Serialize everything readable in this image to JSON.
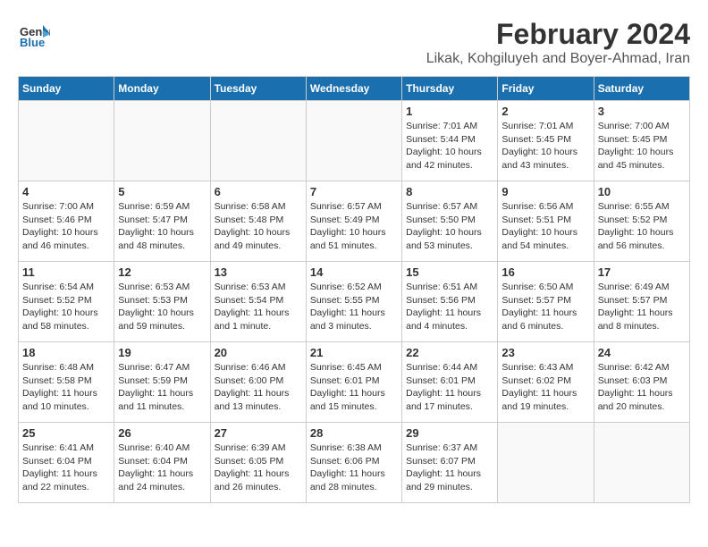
{
  "header": {
    "logo_general": "General",
    "logo_blue": "Blue",
    "month_title": "February 2024",
    "location": "Likak, Kohgiluyeh and Boyer-Ahmad, Iran"
  },
  "days_of_week": [
    "Sunday",
    "Monday",
    "Tuesday",
    "Wednesday",
    "Thursday",
    "Friday",
    "Saturday"
  ],
  "weeks": [
    [
      {
        "day": "",
        "empty": true
      },
      {
        "day": "",
        "empty": true
      },
      {
        "day": "",
        "empty": true
      },
      {
        "day": "",
        "empty": true
      },
      {
        "day": "1",
        "sunrise": "7:01 AM",
        "sunset": "5:44 PM",
        "daylight": "10 hours and 42 minutes."
      },
      {
        "day": "2",
        "sunrise": "7:01 AM",
        "sunset": "5:45 PM",
        "daylight": "10 hours and 43 minutes."
      },
      {
        "day": "3",
        "sunrise": "7:00 AM",
        "sunset": "5:45 PM",
        "daylight": "10 hours and 45 minutes."
      }
    ],
    [
      {
        "day": "4",
        "sunrise": "7:00 AM",
        "sunset": "5:46 PM",
        "daylight": "10 hours and 46 minutes."
      },
      {
        "day": "5",
        "sunrise": "6:59 AM",
        "sunset": "5:47 PM",
        "daylight": "10 hours and 48 minutes."
      },
      {
        "day": "6",
        "sunrise": "6:58 AM",
        "sunset": "5:48 PM",
        "daylight": "10 hours and 49 minutes."
      },
      {
        "day": "7",
        "sunrise": "6:57 AM",
        "sunset": "5:49 PM",
        "daylight": "10 hours and 51 minutes."
      },
      {
        "day": "8",
        "sunrise": "6:57 AM",
        "sunset": "5:50 PM",
        "daylight": "10 hours and 53 minutes."
      },
      {
        "day": "9",
        "sunrise": "6:56 AM",
        "sunset": "5:51 PM",
        "daylight": "10 hours and 54 minutes."
      },
      {
        "day": "10",
        "sunrise": "6:55 AM",
        "sunset": "5:52 PM",
        "daylight": "10 hours and 56 minutes."
      }
    ],
    [
      {
        "day": "11",
        "sunrise": "6:54 AM",
        "sunset": "5:52 PM",
        "daylight": "10 hours and 58 minutes."
      },
      {
        "day": "12",
        "sunrise": "6:53 AM",
        "sunset": "5:53 PM",
        "daylight": "10 hours and 59 minutes."
      },
      {
        "day": "13",
        "sunrise": "6:53 AM",
        "sunset": "5:54 PM",
        "daylight": "11 hours and 1 minute."
      },
      {
        "day": "14",
        "sunrise": "6:52 AM",
        "sunset": "5:55 PM",
        "daylight": "11 hours and 3 minutes."
      },
      {
        "day": "15",
        "sunrise": "6:51 AM",
        "sunset": "5:56 PM",
        "daylight": "11 hours and 4 minutes."
      },
      {
        "day": "16",
        "sunrise": "6:50 AM",
        "sunset": "5:57 PM",
        "daylight": "11 hours and 6 minutes."
      },
      {
        "day": "17",
        "sunrise": "6:49 AM",
        "sunset": "5:57 PM",
        "daylight": "11 hours and 8 minutes."
      }
    ],
    [
      {
        "day": "18",
        "sunrise": "6:48 AM",
        "sunset": "5:58 PM",
        "daylight": "11 hours and 10 minutes."
      },
      {
        "day": "19",
        "sunrise": "6:47 AM",
        "sunset": "5:59 PM",
        "daylight": "11 hours and 11 minutes."
      },
      {
        "day": "20",
        "sunrise": "6:46 AM",
        "sunset": "6:00 PM",
        "daylight": "11 hours and 13 minutes."
      },
      {
        "day": "21",
        "sunrise": "6:45 AM",
        "sunset": "6:01 PM",
        "daylight": "11 hours and 15 minutes."
      },
      {
        "day": "22",
        "sunrise": "6:44 AM",
        "sunset": "6:01 PM",
        "daylight": "11 hours and 17 minutes."
      },
      {
        "day": "23",
        "sunrise": "6:43 AM",
        "sunset": "6:02 PM",
        "daylight": "11 hours and 19 minutes."
      },
      {
        "day": "24",
        "sunrise": "6:42 AM",
        "sunset": "6:03 PM",
        "daylight": "11 hours and 20 minutes."
      }
    ],
    [
      {
        "day": "25",
        "sunrise": "6:41 AM",
        "sunset": "6:04 PM",
        "daylight": "11 hours and 22 minutes."
      },
      {
        "day": "26",
        "sunrise": "6:40 AM",
        "sunset": "6:04 PM",
        "daylight": "11 hours and 24 minutes."
      },
      {
        "day": "27",
        "sunrise": "6:39 AM",
        "sunset": "6:05 PM",
        "daylight": "11 hours and 26 minutes."
      },
      {
        "day": "28",
        "sunrise": "6:38 AM",
        "sunset": "6:06 PM",
        "daylight": "11 hours and 28 minutes."
      },
      {
        "day": "29",
        "sunrise": "6:37 AM",
        "sunset": "6:07 PM",
        "daylight": "11 hours and 29 minutes."
      },
      {
        "day": "",
        "empty": true
      },
      {
        "day": "",
        "empty": true
      }
    ]
  ]
}
